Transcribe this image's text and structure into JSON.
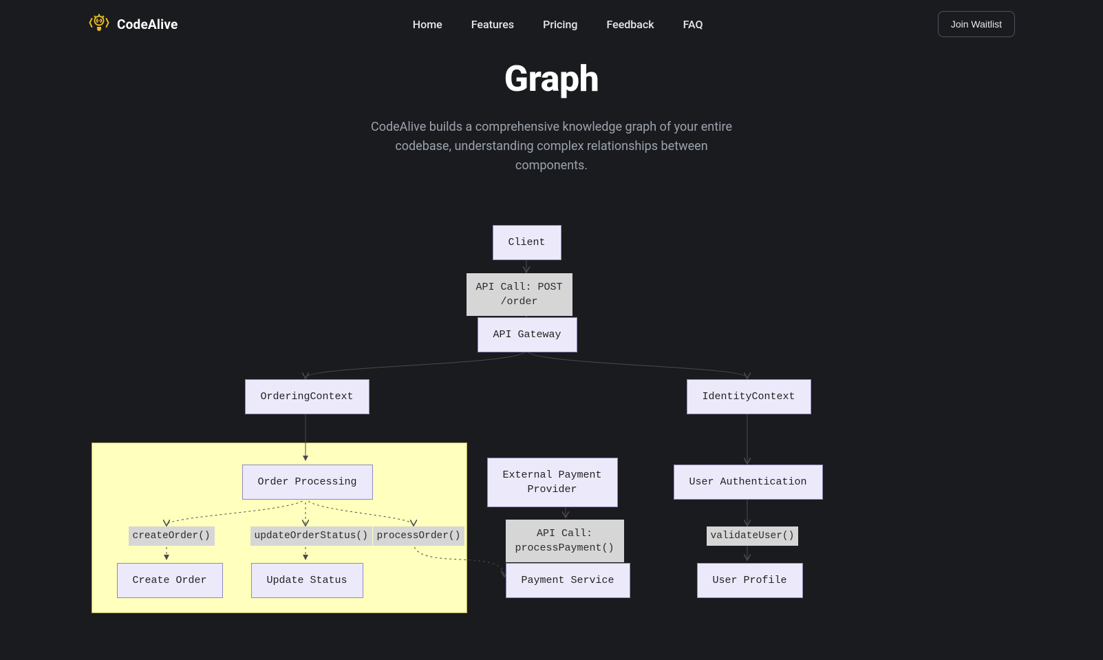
{
  "brand": {
    "name": "CodeAlive"
  },
  "nav": {
    "home": "Home",
    "features": "Features",
    "pricing": "Pricing",
    "feedback": "Feedback",
    "faq": "FAQ"
  },
  "cta": {
    "join": "Join Waitlist"
  },
  "hero": {
    "title": "Graph",
    "subtitle": "CodeAlive builds a comprehensive knowledge graph of your entire codebase, understanding complex relationships between components."
  },
  "diagram": {
    "nodes": {
      "client": "Client",
      "api_call_post": "API Call: POST\n/order",
      "api_gateway": "API Gateway",
      "ordering_context": "OrderingContext",
      "identity_context": "IdentityContext",
      "order_processing": "Order Processing",
      "external_payment": "External Payment\nProvider",
      "user_auth": "User Authentication",
      "create_order_fn": "createOrder()",
      "update_status_fn": "updateOrderStatus()",
      "process_order_fn": "processOrder()",
      "process_payment_fn": "API Call:\nprocessPayment()",
      "validate_user_fn": "validateUser()",
      "create_order": "Create Order",
      "update_status": "Update Status",
      "payment_service": "Payment Service",
      "user_profile": "User Profile"
    }
  }
}
